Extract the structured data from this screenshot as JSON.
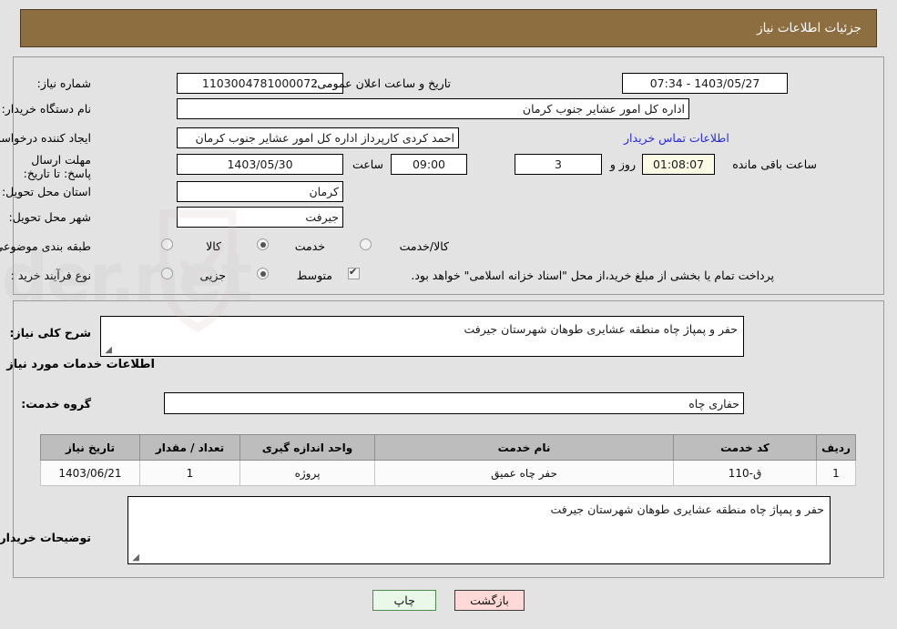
{
  "header": {
    "title": "جزئیات اطلاعات نیاز"
  },
  "top_section": {
    "need_number_label": "شماره نیاز:",
    "need_number_value": "1103004781000072",
    "public_announce_label": "تاریخ و ساعت اعلان عمومی:",
    "public_announce_value": "1403/05/27 - 07:34",
    "buyer_org_label": "نام دستگاه خریدار:",
    "buyer_org_value": "اداره کل امور عشایر جنوب کرمان",
    "creator_label": "ایجاد کننده درخواست:",
    "creator_value": "احمد کردی    کارپرداز اداره کل امور عشایر جنوب کرمان",
    "contact_link": "اطلاعات تماس خریدار",
    "deadline_label": "مهلت ارسال پاسخ: تا تاریخ:",
    "deadline_date": "1403/05/30",
    "deadline_hour_label": "ساعت",
    "deadline_hour": "09:00",
    "days_left": "3",
    "days_unit_label": "روز و",
    "time_left": "01:08:07",
    "time_left_suffix": "ساعت باقی مانده",
    "province_label": "استان محل تحویل:",
    "province_value": "کرمان",
    "city_label": "شهر محل تحویل:",
    "city_value": "جیرفت",
    "category_label": "طبقه بندی موضوعی:",
    "category_options": [
      {
        "label": "کالا",
        "selected": false
      },
      {
        "label": "خدمت",
        "selected": true
      },
      {
        "label": "کالا/خدمت",
        "selected": false
      }
    ],
    "process_label": "نوع فرآیند خرید :",
    "process_options": [
      {
        "label": "جزیی",
        "selected": false
      },
      {
        "label": "متوسط",
        "selected": true
      }
    ],
    "treasury_checkbox_checked": true,
    "treasury_text": "پرداخت تمام یا بخشی از مبلغ خرید،از محل \"اسناد خزانه اسلامی\" خواهد بود."
  },
  "mid_section": {
    "general_desc_label": "شرح کلی نیاز:",
    "general_desc_value": "حفر و پمپاژ چاه منطقه عشایری طوهان شهرستان جیرفت",
    "services_caption": "اطلاعات خدمات مورد نیاز",
    "service_group_label": "گروه خدمت:",
    "service_group_value": "حفاری چاه",
    "buyer_notes_label": "توضیحات خریدار:",
    "buyer_notes_value": "حفر و پمپاژ چاه منطقه عشایری طوهان شهرستان جیرفت"
  },
  "table": {
    "headers": [
      "ردیف",
      "کد خدمت",
      "نام خدمت",
      "واحد اندازه گیری",
      "تعداد / مقدار",
      "تاریخ نیاز"
    ],
    "rows": [
      {
        "row_no": "1",
        "service_code": "ق-110",
        "service_name": "حفر چاه عمیق",
        "unit": "پروژه",
        "quantity": "1",
        "need_date": "1403/06/21"
      }
    ]
  },
  "footer": {
    "back_label": "بازگشت",
    "print_label": "چاپ"
  },
  "colors": {
    "header_bg": "#8d6e40",
    "page_bg": "#e3e3e3",
    "link": "#2b2bd8",
    "table_header_bg": "#bdbdbd",
    "back_btn_bg": "#ffd8d8",
    "print_btn_bg": "#eaf8ea",
    "timer_bg": "#fbfbe5"
  }
}
